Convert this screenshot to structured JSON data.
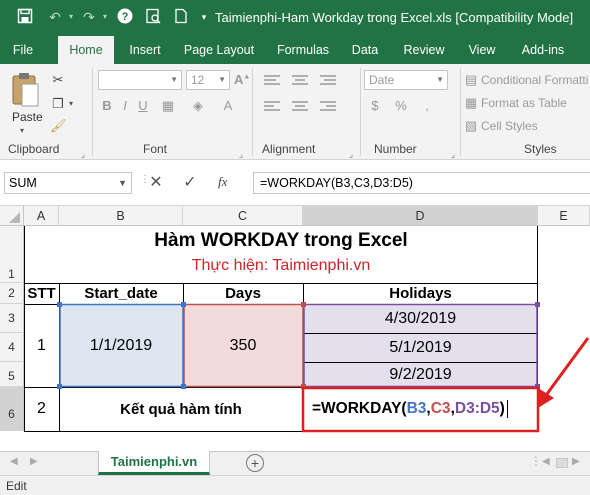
{
  "window": {
    "title": "Taimienphi-Ham Workday trong Excel.xls  [Compatibility Mode]"
  },
  "tabs": [
    "File",
    "Home",
    "Insert",
    "Page Layout",
    "Formulas",
    "Data",
    "Review",
    "View",
    "Add-ins"
  ],
  "ribbon": {
    "paste_label": "Paste",
    "font_name": "",
    "font_size": "12",
    "number_format": "Date",
    "conditional_formatting": "Conditional Formatti",
    "format_as_table": "Format as Table",
    "cell_styles": "Cell Styles",
    "groups": {
      "clipboard": "Clipboard",
      "font": "Font",
      "alignment": "Alignment",
      "number": "Number",
      "styles": "Styles"
    }
  },
  "formula_bar": {
    "name_box": "SUM",
    "fx": "fx",
    "formula": "=WORKDAY(B3,C3,D3:D5)"
  },
  "columns": [
    "A",
    "B",
    "C",
    "D",
    "E"
  ],
  "rows": [
    "1",
    "2",
    "3",
    "4",
    "5",
    "6"
  ],
  "sheet": {
    "title": "Hàm WORKDAY trong Excel",
    "subtitle": "Thực hiện: Taimienphi.vn",
    "headers": {
      "stt": "STT",
      "start_date": "Start_date",
      "days": "Days",
      "holidays": "Holidays"
    },
    "row1": {
      "stt": "1",
      "start_date": "1/1/2019",
      "days": "350"
    },
    "holidays": [
      "4/30/2019",
      "5/1/2019",
      "9/2/2019"
    ],
    "row2": {
      "stt": "2",
      "label": "Kết quả hàm tính"
    },
    "formula_parts": {
      "prefix": "=WORKDAY(",
      "b3": "B3",
      "c1": ",",
      "c3": "C3",
      "c2": ",",
      "range": "D3:D5",
      "suffix": ")"
    }
  },
  "sheet_tab": "Taimienphi.vn",
  "status": "Edit",
  "colors": {
    "excel_green": "#217346",
    "b3_ref": "#4472c4",
    "c3_ref": "#c0504d",
    "range_ref": "#7b4fa0",
    "annotation_red": "#e02020"
  }
}
